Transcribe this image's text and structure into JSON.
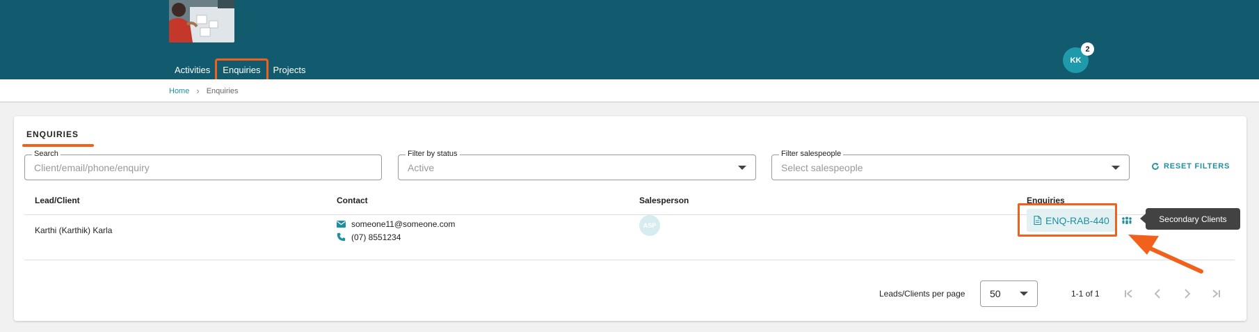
{
  "header": {
    "nav": [
      {
        "label": "Activities"
      },
      {
        "label": "Enquiries"
      },
      {
        "label": "Projects"
      }
    ],
    "avatar_initials": "KK",
    "notification_count": "2"
  },
  "breadcrumb": {
    "home": "Home",
    "current": "Enquiries"
  },
  "page": {
    "title": "ENQUIRIES",
    "filters": {
      "search_label": "Search",
      "search_placeholder": "Client/email/phone/enquiry",
      "status_label": "Filter by status",
      "status_value": "Active",
      "salespeople_label": "Filter salespeople",
      "salespeople_placeholder": "Select salespeople",
      "reset_label": "RESET FILTERS"
    },
    "table": {
      "columns": [
        "Lead/Client",
        "Contact",
        "Salesperson",
        "Enquiries"
      ],
      "rows": [
        {
          "client": "Karthi (Karthik) Karla",
          "email": "someone11@someone.com",
          "phone": "(07) 8551234",
          "salesperson": "ASP",
          "enquiry": "ENQ-RAB-440"
        }
      ]
    },
    "tooltip": "Secondary Clients",
    "pagination": {
      "per_page_label": "Leads/Clients per page",
      "per_page_value": "50",
      "range": "1-1 of 1"
    }
  },
  "colors": {
    "header_bg": "#125a6e",
    "accent": "#1f8fa0",
    "highlight": "#f2611c"
  }
}
